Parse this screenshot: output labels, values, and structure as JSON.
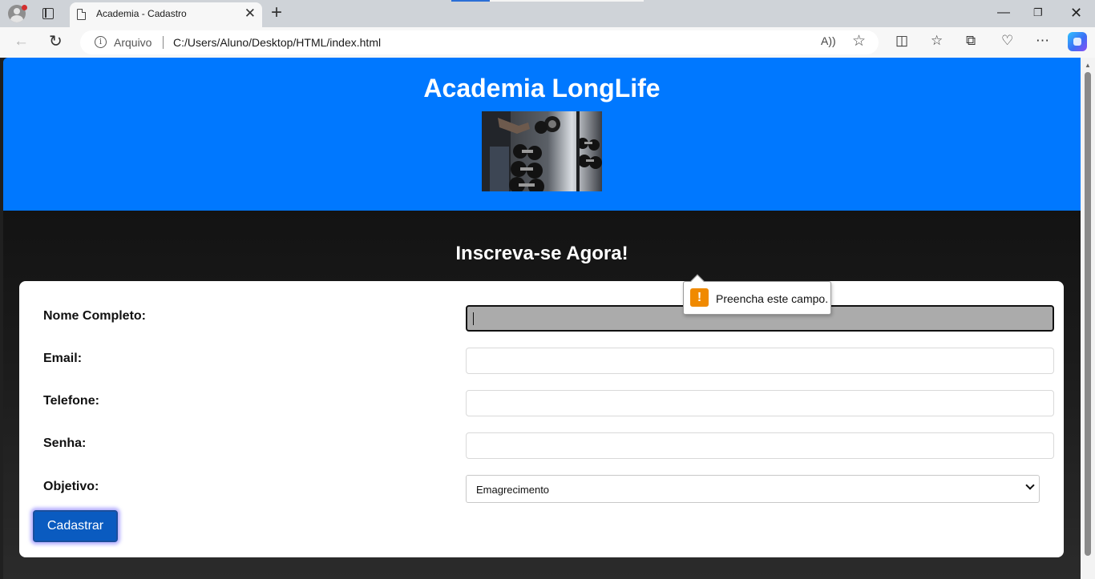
{
  "browser": {
    "tab_title": "Academia - Cadastro",
    "tab_close": "✕",
    "new_tab": "+",
    "window_controls": {
      "minimize": "—",
      "restore": "❐",
      "close": "✕"
    },
    "nav": {
      "back": "←",
      "reload": "↻"
    },
    "address": {
      "scheme_label": "Arquivo",
      "url": "C:/Users/Aluno/Desktop/HTML/index.html"
    },
    "toolbar_icons": [
      "read-aloud-icon",
      "favorite-star-icon",
      "split-screen-icon",
      "favorites-icon",
      "collections-icon",
      "browser-essentials-icon",
      "more-icon",
      "copilot-icon"
    ]
  },
  "page": {
    "site_title": "Academia LongLife",
    "hero_image": "gym-dumbbells-photo",
    "signup_title": "Inscreva-se Agora!",
    "form": {
      "fields": [
        {
          "label": "Nome Completo:",
          "value": "",
          "focused": true
        },
        {
          "label": "Email:",
          "value": ""
        },
        {
          "label": "Telefone:",
          "value": ""
        },
        {
          "label": "Senha:",
          "value": ""
        }
      ],
      "objective": {
        "label": "Objetivo:",
        "selected": "Emagrecimento"
      },
      "submit_label": "Cadastrar"
    },
    "validation": {
      "message": "Preencha este campo.",
      "icon": "warning-icon",
      "icon_glyph": "!"
    }
  },
  "colors": {
    "header_bg": "#0078ff",
    "button_bg": "#0a5bc0",
    "warning": "#f08a00"
  }
}
